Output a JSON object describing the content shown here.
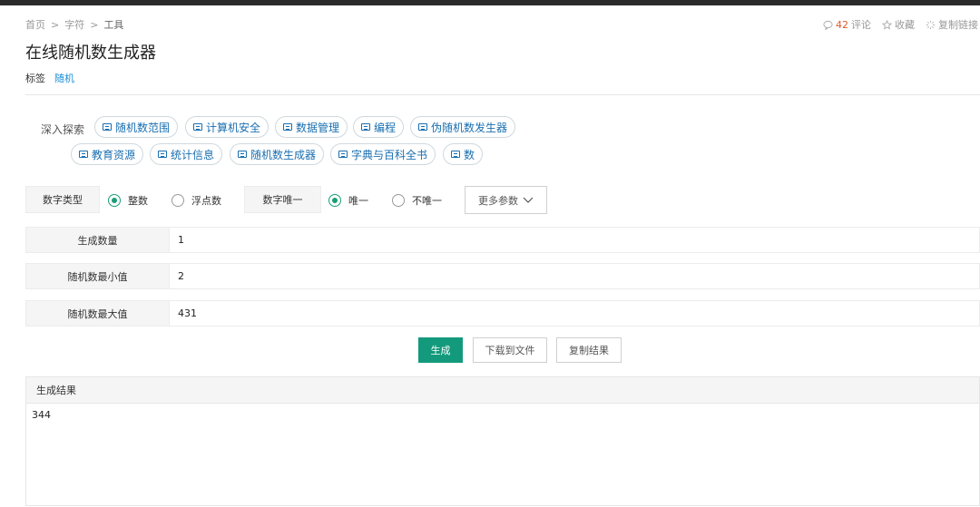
{
  "breadcrumb": {
    "home": "首页",
    "sep": ">",
    "category": "字符",
    "current": "工具"
  },
  "actions": {
    "comment_count": "42",
    "comment_label": "评论",
    "favorite_label": "收藏",
    "copy_link_label": "复制链接"
  },
  "page": {
    "title": "在线随机数生成器",
    "tags_label": "标签",
    "tags": [
      "随机"
    ]
  },
  "explore": {
    "label": "深入探索",
    "chips": [
      "随机数范围",
      "计算机安全",
      "数据管理",
      "编程",
      "伪随机数发生器",
      "教育资源",
      "统计信息",
      "随机数生成器",
      "字典与百科全书",
      "数"
    ]
  },
  "options": {
    "number_type_label": "数字类型",
    "number_type_options": [
      "整数",
      "浮点数"
    ],
    "number_type_selected": "整数",
    "unique_label": "数字唯一",
    "unique_options": [
      "唯一",
      "不唯一"
    ],
    "unique_selected": "唯一",
    "more_label": "更多参数"
  },
  "fields": {
    "count": {
      "label": "生成数量",
      "value": "1"
    },
    "min": {
      "label": "随机数最小值",
      "value": "2"
    },
    "max": {
      "label": "随机数最大值",
      "value": "431"
    }
  },
  "buttons": {
    "generate": "生成",
    "download": "下载到文件",
    "copy": "复制结果"
  },
  "result": {
    "title": "生成结果",
    "value": "344"
  },
  "colors": {
    "accent": "#139a7c",
    "link": "#1a8fd8",
    "chip_text": "#1a6fb0",
    "count": "#e05a2b"
  }
}
